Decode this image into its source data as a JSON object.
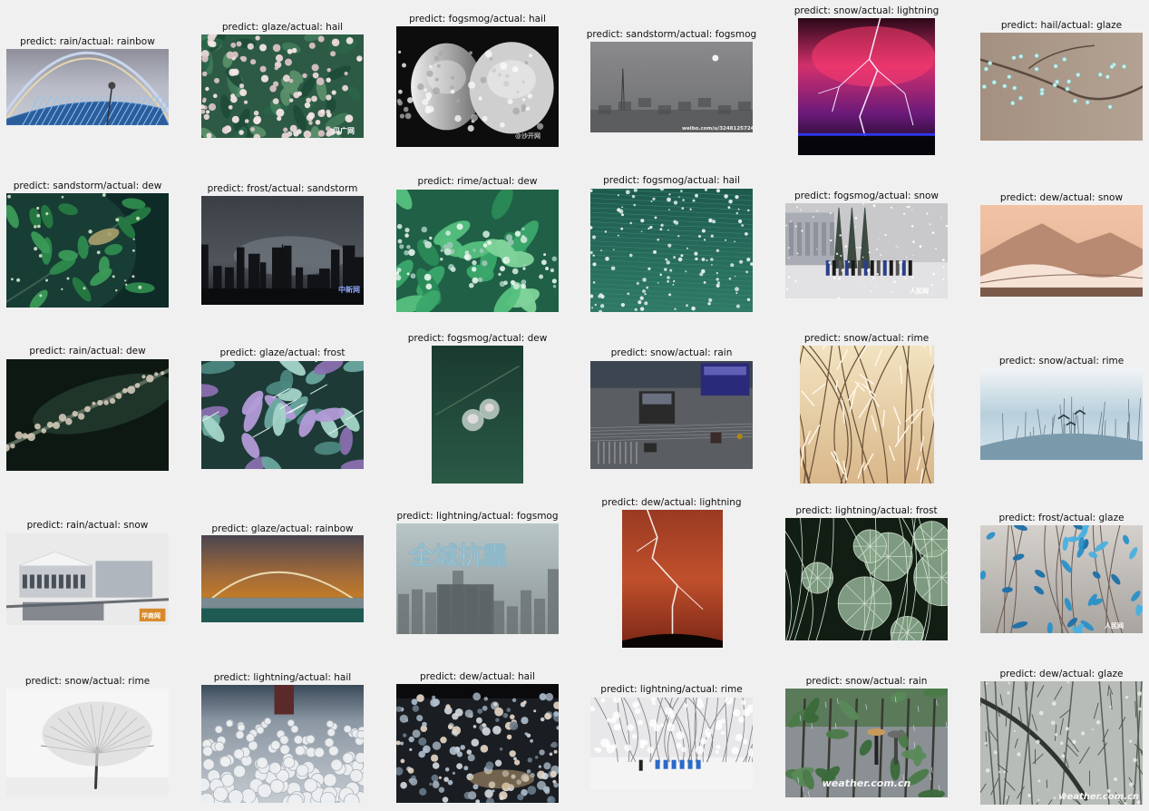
{
  "panels": [
    {
      "predicted": "rain",
      "actual": "rainbow",
      "title": "predict: rain/actual: rainbow",
      "scene": "stadium-rainbow"
    },
    {
      "predicted": "glaze",
      "actual": "hail",
      "title": "predict: glaze/actual: hail",
      "scene": "leaves-hail",
      "watermark": "贝广网"
    },
    {
      "predicted": "fogsmog",
      "actual": "hail",
      "title": "predict: fogsmog/actual: hail",
      "scene": "egg-hailstone",
      "watermark": "@沙开网"
    },
    {
      "predicted": "sandstorm",
      "actual": "fogsmog",
      "title": "predict: sandstorm/actual: fogsmog",
      "scene": "foggy-tower",
      "watermark": "weibo.com/u/3248125724"
    },
    {
      "predicted": "snow",
      "actual": "lightning",
      "title": "predict: snow/actual: lightning",
      "scene": "magenta-lightning"
    },
    {
      "predicted": "hail",
      "actual": "glaze",
      "title": "predict: hail/actual: glaze",
      "scene": "ice-branch"
    },
    {
      "predicted": "sandstorm",
      "actual": "dew",
      "title": "predict: sandstorm/actual: dew",
      "scene": "dew-leaves"
    },
    {
      "predicted": "frost",
      "actual": "sandstorm",
      "title": "predict: frost/actual: sandstorm",
      "scene": "dark-city",
      "watermark": "中新网"
    },
    {
      "predicted": "rime",
      "actual": "dew",
      "title": "predict: rime/actual: dew",
      "scene": "green-dew"
    },
    {
      "predicted": "fogsmog",
      "actual": "hail",
      "title": "predict: fogsmog/actual: hail",
      "scene": "green-hail"
    },
    {
      "predicted": "fogsmog",
      "actual": "snow",
      "title": "predict: fogsmog/actual: snow",
      "scene": "snow-people",
      "watermark": "人民网"
    },
    {
      "predicted": "dew",
      "actual": "snow",
      "title": "predict: dew/actual: snow",
      "scene": "peach-mountain"
    },
    {
      "predicted": "rain",
      "actual": "dew",
      "title": "predict: rain/actual: dew",
      "scene": "dew-macro"
    },
    {
      "predicted": "glaze",
      "actual": "frost",
      "title": "predict: glaze/actual: frost",
      "scene": "frost-fern"
    },
    {
      "predicted": "fogsmog",
      "actual": "dew",
      "title": "predict: fogsmog/actual: dew",
      "scene": "dew-drops"
    },
    {
      "predicted": "snow",
      "actual": "rain",
      "title": "predict: snow/actual: rain",
      "scene": "rain-street"
    },
    {
      "predicted": "snow",
      "actual": "rime",
      "title": "predict: snow/actual: rime",
      "scene": "golden-rime"
    },
    {
      "predicted": "snow",
      "actual": "rime",
      "title": "predict: snow/actual: rime",
      "scene": "blue-rime"
    },
    {
      "predicted": "rain",
      "actual": "snow",
      "title": "predict: rain/actual: snow",
      "scene": "snow-building",
      "watermark": "华商网"
    },
    {
      "predicted": "glaze",
      "actual": "rainbow",
      "title": "predict: glaze/actual: rainbow",
      "scene": "orange-rainbow"
    },
    {
      "predicted": "lightning",
      "actual": "fogsmog",
      "title": "predict: lightning/actual: fogsmog",
      "scene": "smog-city",
      "caption": "全城抗霾"
    },
    {
      "predicted": "dew",
      "actual": "lightning",
      "title": "predict: dew/actual: lightning",
      "scene": "red-lightning"
    },
    {
      "predicted": "lightning",
      "actual": "frost",
      "title": "predict: lightning/actual: frost",
      "scene": "frost-leaves"
    },
    {
      "predicted": "frost",
      "actual": "glaze",
      "title": "predict: frost/actual: glaze",
      "scene": "blue-glaze",
      "watermark": "人民网"
    },
    {
      "predicted": "snow",
      "actual": "rime",
      "title": "predict: snow/actual: rime",
      "scene": "white-tree"
    },
    {
      "predicted": "lightning",
      "actual": "hail",
      "title": "predict: lightning/actual: hail",
      "scene": "hail-ground"
    },
    {
      "predicted": "dew",
      "actual": "hail",
      "title": "predict: dew/actual: hail",
      "scene": "hail-water"
    },
    {
      "predicted": "lightning",
      "actual": "rime",
      "title": "predict: lightning/actual: rime",
      "scene": "snow-road"
    },
    {
      "predicted": "snow",
      "actual": "rain",
      "title": "predict: snow/actual: rain",
      "scene": "rain-people",
      "watermark": "weather.com.cn"
    },
    {
      "predicted": "dew",
      "actual": "glaze",
      "title": "predict: dew/actual: glaze",
      "scene": "glaze-forest",
      "watermark": "weather.com.cn"
    }
  ]
}
